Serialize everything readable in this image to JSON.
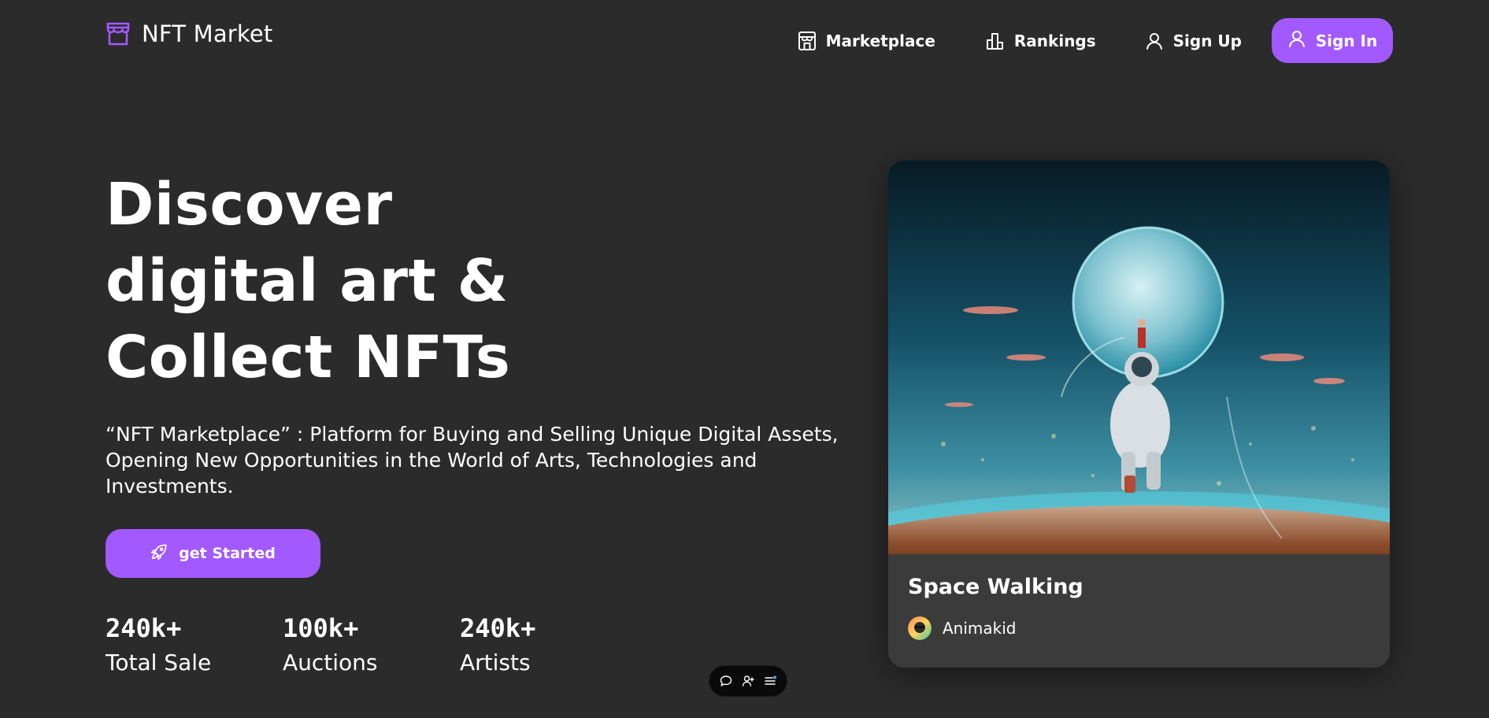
{
  "header": {
    "logo_text": "NFT Market",
    "nav": {
      "marketplace": "Marketplace",
      "rankings": "Rankings",
      "sign_up": "Sign Up",
      "sign_in": "Sign In"
    }
  },
  "hero": {
    "title_line1": "Discover",
    "title_line2": "digital art &",
    "title_line3": "Collect NFTs",
    "description": "“NFT Marketplace” : Platform for Buying and Selling Unique Digital Assets, Opening New Opportunities in the World of Arts, Technologies and Investments.",
    "cta_label": "get Started",
    "stats": [
      {
        "value": "240k+",
        "label": "Total Sale"
      },
      {
        "value": "100k+",
        "label": "Auctions"
      },
      {
        "value": "240k+",
        "label": "Artists"
      }
    ]
  },
  "featured_card": {
    "title": "Space Walking",
    "artist": "Animakid"
  },
  "toolbar": {
    "icons": [
      "chat-icon",
      "add-user-icon",
      "menu-icon"
    ]
  },
  "colors": {
    "background": "#2b2b2b",
    "accent": "#a259ff",
    "card": "#3b3b3b"
  }
}
